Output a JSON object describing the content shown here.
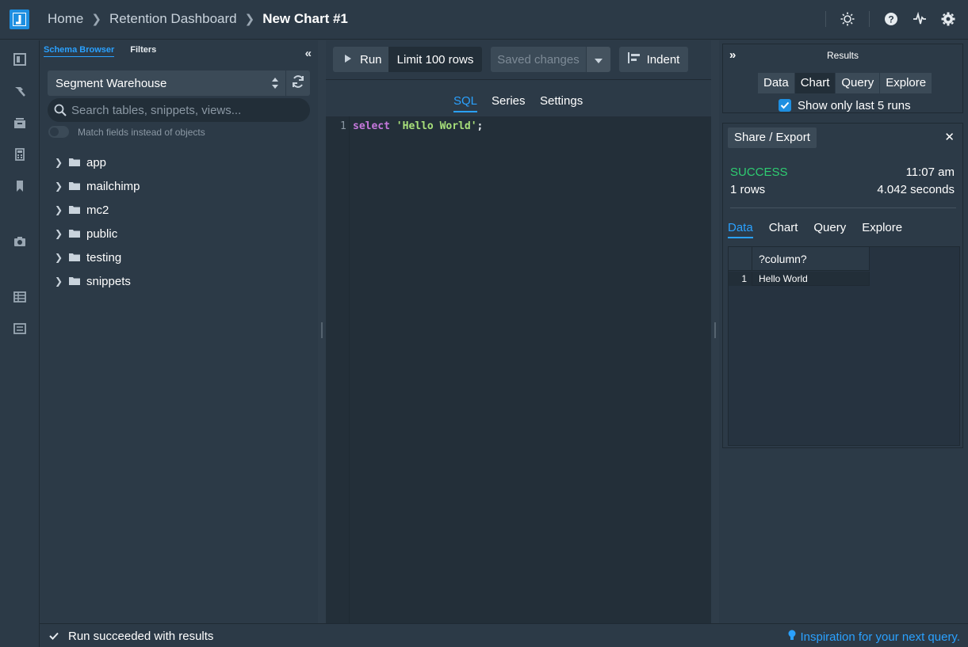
{
  "breadcrumb": {
    "home": "Home",
    "dashboard": "Retention Dashboard",
    "current": "New Chart #1"
  },
  "icons": {
    "theme": "sun-icon",
    "help": "help-icon",
    "activity": "pulse-icon",
    "settings": "gear-icon"
  },
  "sidebar_tabs": {
    "schema": "Schema Browser",
    "filters": "Filters"
  },
  "warehouse": {
    "selected": "Segment Warehouse"
  },
  "search": {
    "placeholder": "Search tables, snippets, views..."
  },
  "match_label": "Match fields instead of objects",
  "schemas": [
    "app",
    "mailchimp",
    "mc2",
    "public",
    "testing",
    "snippets"
  ],
  "toolbar": {
    "run": "Run",
    "limit": "Limit 100 rows",
    "saved": "Saved changes",
    "indent": "Indent"
  },
  "editor_tabs": {
    "sql": "SQL",
    "series": "Series",
    "settings": "Settings"
  },
  "editor": {
    "line_number": "1",
    "kw": "select",
    "str": "'Hello World'",
    "pun": ";"
  },
  "results_panel": {
    "title": "Results",
    "tabs": [
      "Data",
      "Chart",
      "Query",
      "Explore"
    ],
    "active_tab": "Chart",
    "show_last_runs": "Show only last 5 runs"
  },
  "run_panel": {
    "share_export": "Share / Export",
    "status": "SUCCESS",
    "time": "11:07 am",
    "rows": "1 rows",
    "duration": "4.042 seconds",
    "tabs": [
      "Data",
      "Chart",
      "Query",
      "Explore"
    ],
    "active_tab": "Data",
    "table": {
      "header": "?column?",
      "row_index": "1",
      "cell": "Hello World"
    }
  },
  "footer": {
    "status": "Run succeeded with results",
    "tip": "Inspiration for your next query."
  },
  "colors": {
    "accent": "#2aa1ff",
    "success": "#2ecc71",
    "keyword": "#c678dd",
    "string": "#a8e07a"
  }
}
